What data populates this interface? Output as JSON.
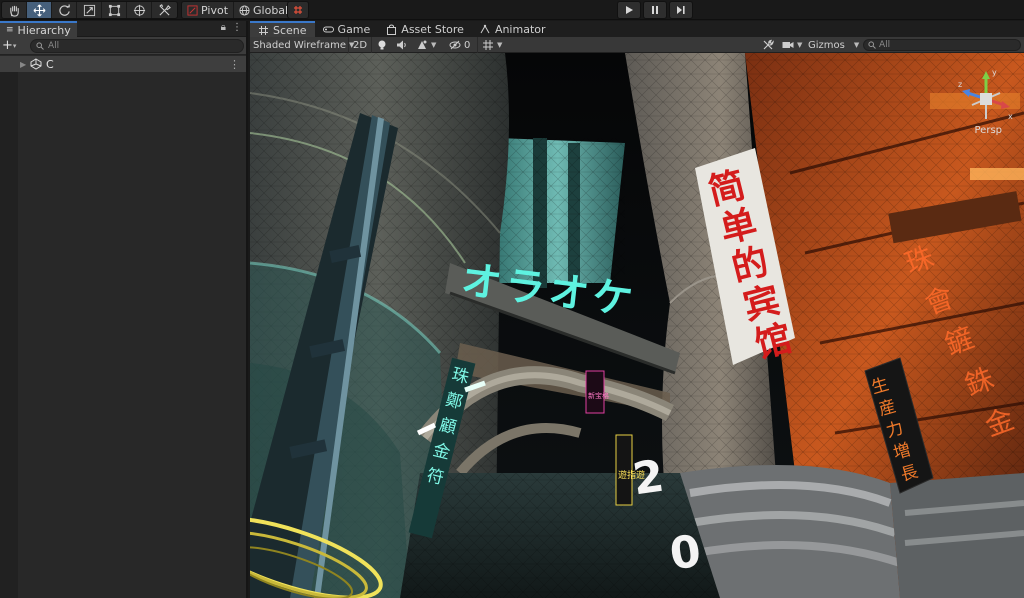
{
  "toolbar": {
    "tools": [
      "hand-tool",
      "move-tool",
      "rotate-tool",
      "scale-tool",
      "rect-tool",
      "transform-tool",
      "custom-tool"
    ],
    "pivot_label": "Pivot",
    "global_label": "Global"
  },
  "hierarchy": {
    "tab_label": "Hierarchy",
    "search_placeholder": "All",
    "root_item": "C"
  },
  "scene": {
    "tabs": [
      {
        "label": "Scene",
        "icon": "grid-icon"
      },
      {
        "label": "Game",
        "icon": "gamepad-icon"
      },
      {
        "label": "Asset Store",
        "icon": "bag-icon"
      },
      {
        "label": "Animator",
        "icon": "animator-icon"
      }
    ],
    "shading_mode": "Shaded Wireframe",
    "mode_2d": "2D",
    "hidden_count": "0",
    "gizmos_label": "Gizmos",
    "search_placeholder": "All",
    "projection_label": "Persp"
  },
  "signs": {
    "katakana": "オラオケ",
    "hotel": [
      "简",
      "单",
      "的",
      "宾",
      "馆"
    ],
    "growth": [
      "生",
      "産",
      "力",
      "増",
      "長"
    ],
    "right_vertical": [
      "珠",
      "會",
      "鏟",
      "銖",
      "金"
    ],
    "left_vertical": [
      "珠",
      "鄭",
      "顧",
      "金",
      "符"
    ],
    "small_pink": "新宝格",
    "yellow_vertical": "遊指遊",
    "number_top": "2",
    "number_bottom": "0"
  },
  "colors": {
    "accent_tab": "#3a78c9",
    "active_tool": "#46607c",
    "neon_cyan": "#5ef2e0",
    "neon_red": "#d41c1c"
  }
}
